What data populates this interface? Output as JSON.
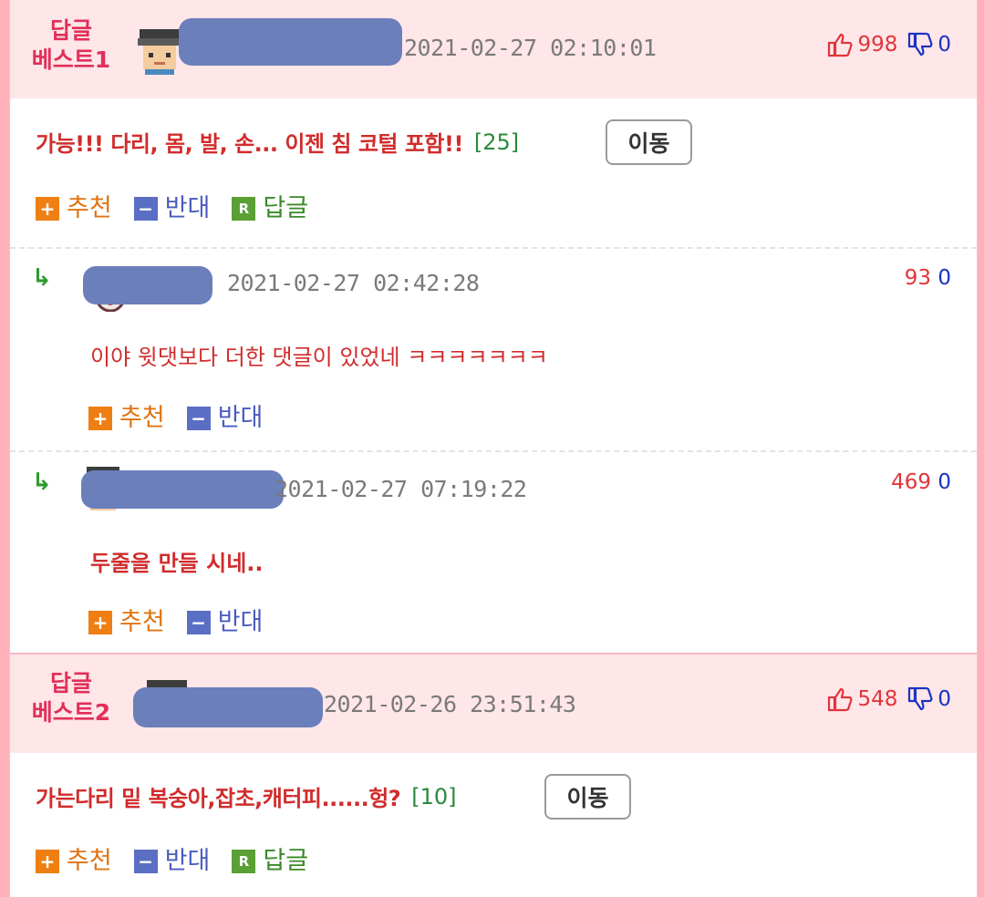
{
  "best1": {
    "badge_line1": "답글",
    "badge_line2": "베스트1",
    "datetime": "2021-02-27 02:10:01",
    "up": "998",
    "down": "0",
    "title": "가능!!! 다리, 몸, 발, 손... 이젠 침 코털 포함!!",
    "count": "[25]",
    "move_label": "이동",
    "recommend": "추천",
    "oppose": "반대",
    "reply": "답글"
  },
  "replies": [
    {
      "datetime": "2021-02-27 02:42:28",
      "up": "93",
      "down": "0",
      "text": "이야 윗댓보다 더한 댓글이 있었네 ㅋㅋㅋㅋㅋㅋㅋ",
      "recommend": "추천",
      "oppose": "반대"
    },
    {
      "datetime": "2021-02-27 07:19:22",
      "up": "469",
      "down": "0",
      "text": "두줄을 만들 시네..",
      "recommend": "추천",
      "oppose": "반대"
    }
  ],
  "best2": {
    "badge_line1": "답글",
    "badge_line2": "베스트2",
    "datetime": "2021-02-26 23:51:43",
    "up": "548",
    "down": "0",
    "title": "가는다리 밑 복숭아,잡초,캐터피......헝?",
    "count": "[10]",
    "move_label": "이동",
    "recommend": "추천",
    "oppose": "반대",
    "reply": "답글"
  },
  "icons": {
    "plus": "+",
    "minus": "−",
    "reply_box": "R",
    "reply_arrow": "↳"
  },
  "colors": {
    "header_bg": "#ffe6e9",
    "badge": "#e0305a",
    "title_red": "#d12c2c",
    "count_green": "#2a8a3c",
    "up_red": "#e0353a",
    "down_blue": "#1a33c0",
    "blur": "#6b7fbb"
  }
}
